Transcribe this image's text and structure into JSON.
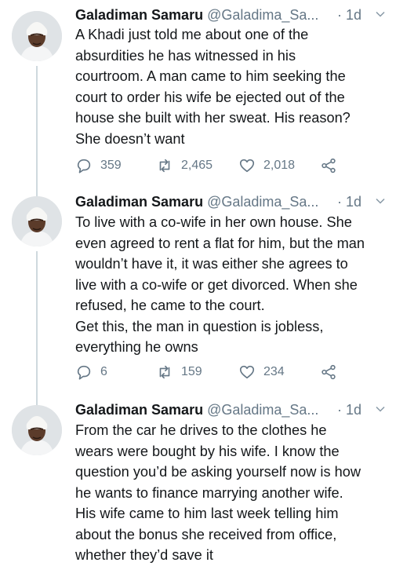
{
  "tweets": [
    {
      "name": "Galadiman Samaru",
      "handle": "@Galadima_Sa...",
      "time": "· 1d",
      "lines": [
        "A Khadi just told me about one of the",
        "absurdities he has witnessed in his",
        "courtroom. A man came to him seeking the",
        "court to order his wife be ejected out of the",
        "house she built with her sweat. His reason?",
        "She doesn’t want"
      ],
      "replies": "359",
      "retweets": "2,465",
      "likes": "2,018"
    },
    {
      "name": "Galadiman Samaru",
      "handle": "@Galadima_Sa...",
      "time": "· 1d",
      "lines": [
        "To live with a co-wife in her own house. She",
        "even agreed to rent a flat for him, but the man",
        "wouldn’t have it, it was either she agrees to",
        "live with a co-wife or get divorced. When she",
        "refused, he came to the court.",
        "Get this, the man in question is jobless,",
        "everything he owns"
      ],
      "replies": "6",
      "retweets": "159",
      "likes": "234"
    },
    {
      "name": "Galadiman Samaru",
      "handle": "@Galadima_Sa...",
      "time": "· 1d",
      "lines": [
        "From the car he drives to the clothes he",
        "wears were bought by his wife. I know the",
        "question you’d be asking yourself now is how",
        "he wants to finance marrying another wife.",
        "His wife came to him last week telling him",
        "about the bonus she received from office,",
        "whether they’d save it"
      ]
    }
  ],
  "icons": {
    "reply": "comment-bubble-icon",
    "retweet": "retweet-arrows-icon",
    "like": "heart-outline-icon",
    "share": "share-nodes-icon",
    "menu": "chevron-down-icon"
  },
  "colors": {
    "text": "#14171a",
    "secondary": "#657786",
    "thread_line": "#cfd9de",
    "background": "#ffffff"
  }
}
